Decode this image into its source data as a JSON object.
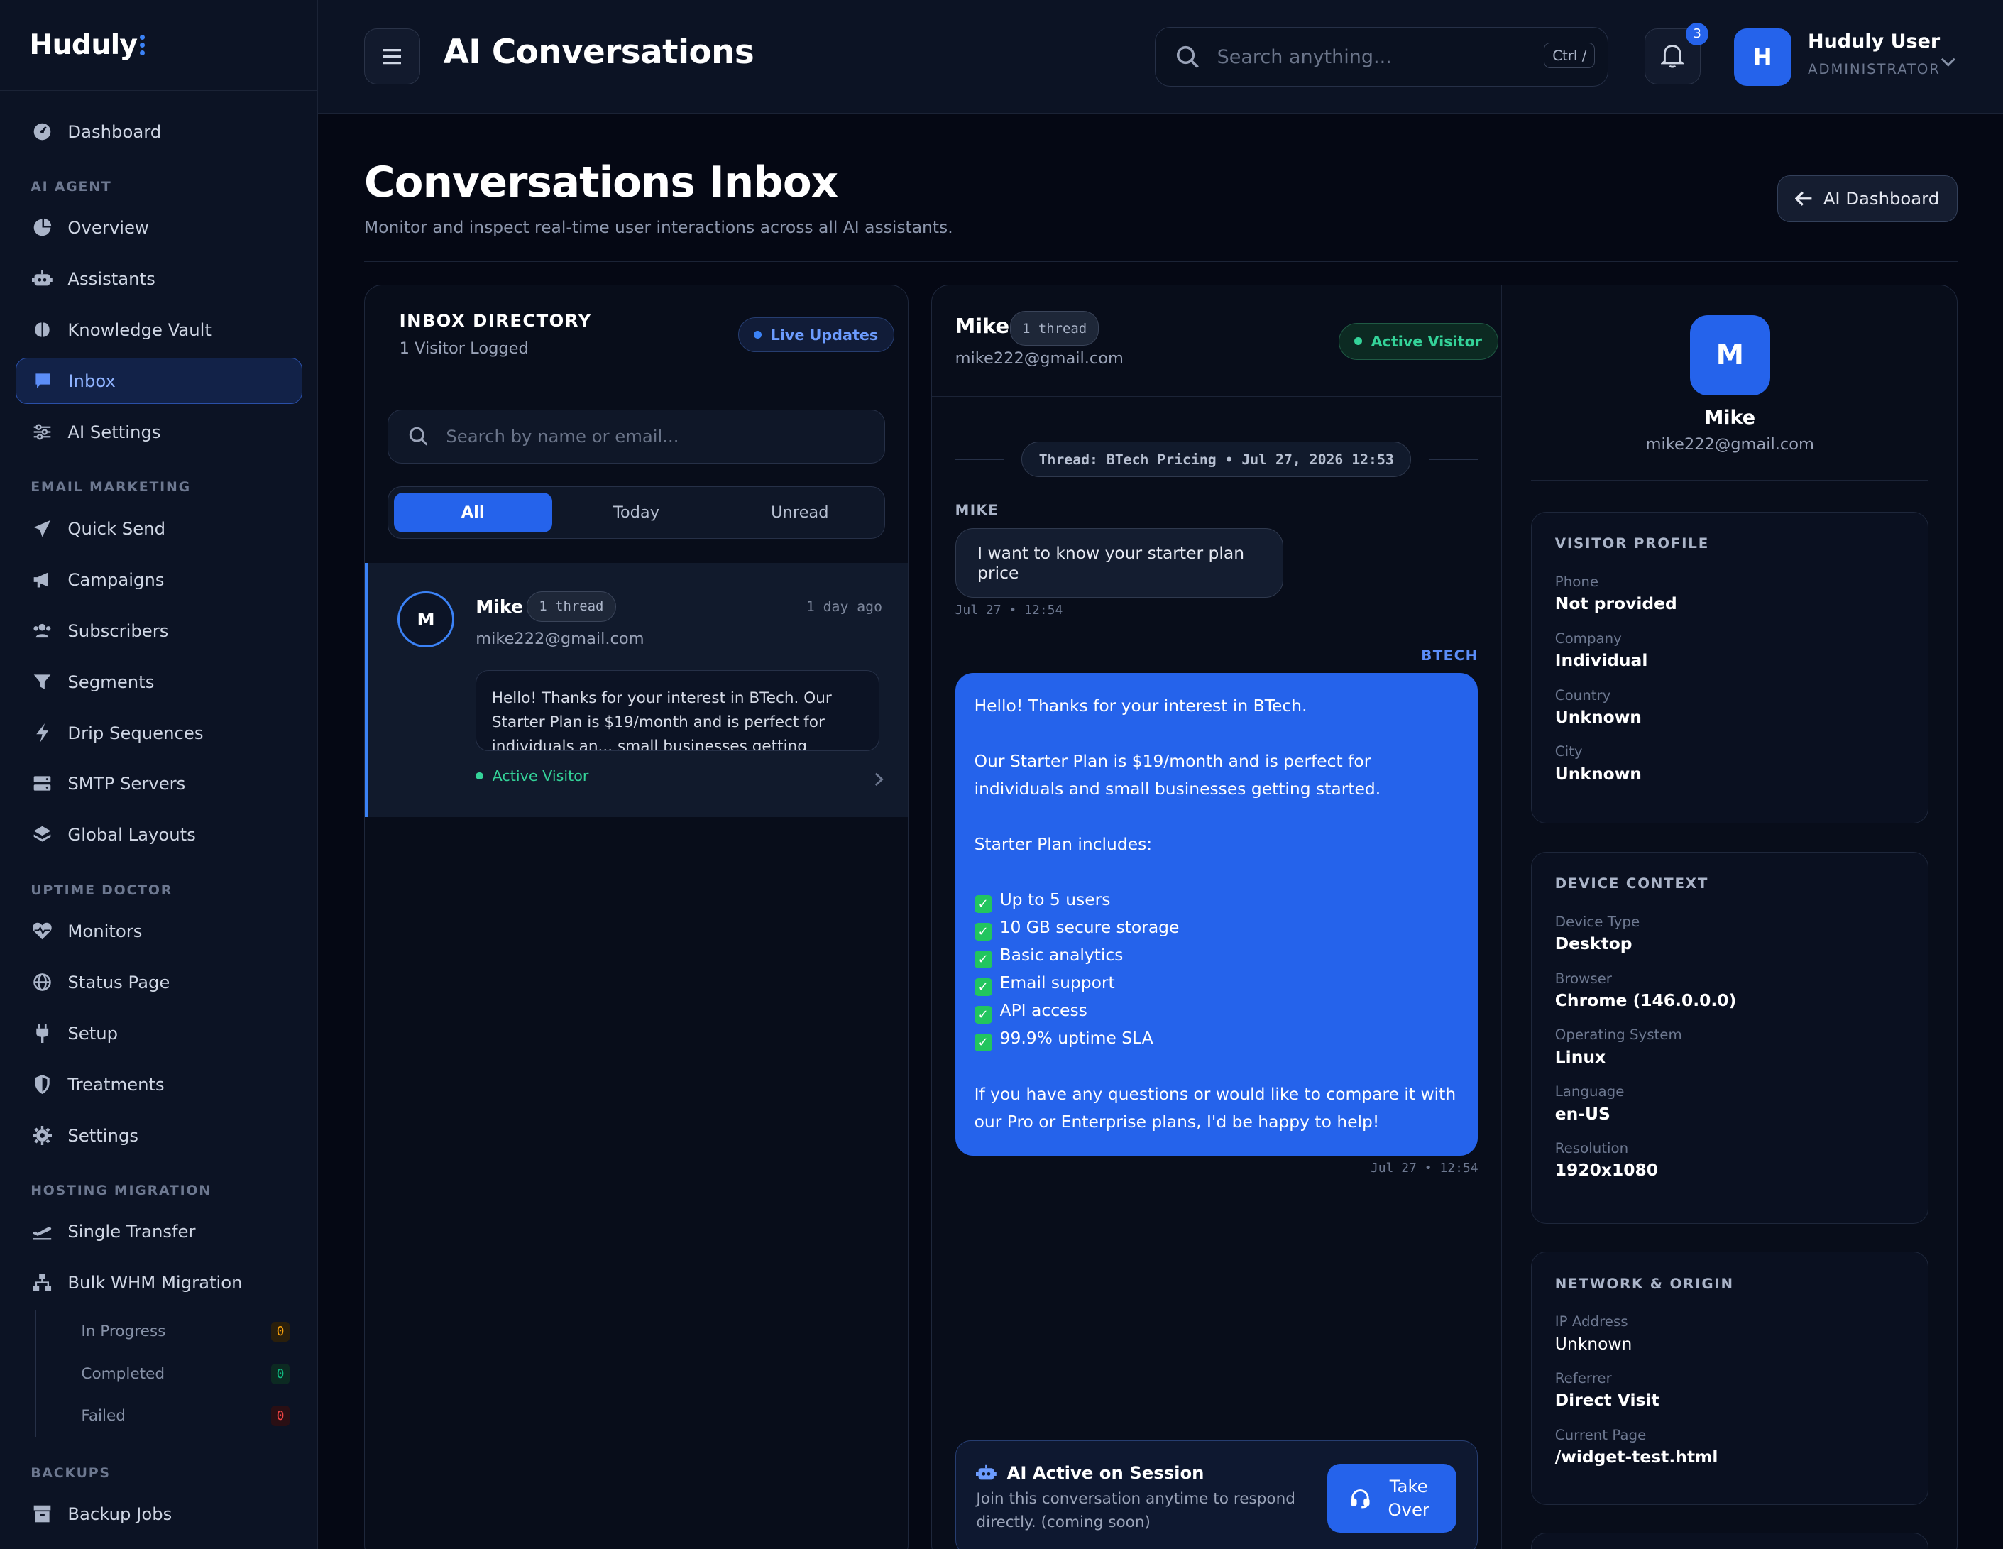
{
  "app": {
    "logo": "Huduly",
    "top_title": "AI Conversations"
  },
  "sidebar": {
    "dashboard": "Dashboard",
    "sections": [
      {
        "title": "AI AGENT",
        "items": [
          "Overview",
          "Assistants",
          "Knowledge Vault",
          "Inbox",
          "AI Settings"
        ]
      },
      {
        "title": "EMAIL MARKETING",
        "items": [
          "Quick Send",
          "Campaigns",
          "Subscribers",
          "Segments",
          "Drip Sequences",
          "SMTP Servers",
          "Global Layouts"
        ]
      },
      {
        "title": "UPTIME DOCTOR",
        "items": [
          "Monitors",
          "Status Page",
          "Setup",
          "Treatments",
          "Settings"
        ]
      },
      {
        "title": "HOSTING MIGRATION",
        "items": [
          "Single Transfer",
          "Bulk WHM Migration"
        ]
      },
      {
        "title": "BACKUPS",
        "items": [
          "Backup Jobs"
        ]
      }
    ],
    "sub_items": [
      {
        "label": "In Progress",
        "count": "0",
        "color": "#f59e0b"
      },
      {
        "label": "Completed",
        "count": "0",
        "color": "#10b981"
      },
      {
        "label": "Failed",
        "count": "0",
        "color": "#ef4444"
      }
    ]
  },
  "topbar": {
    "search_placeholder": "Search anything...",
    "shortcut": "Ctrl /",
    "notifications": "3",
    "user_initial": "H",
    "user_name": "Huduly User",
    "user_role": "ADMINISTRATOR"
  },
  "page": {
    "title": "Conversations Inbox",
    "subtitle": "Monitor and inspect real-time user interactions across all AI assistants.",
    "back_button": "AI Dashboard"
  },
  "inbox": {
    "title": "INBOX DIRECTORY",
    "count": "1 Visitor Logged",
    "live": "Live Updates",
    "search_placeholder": "Search by name or email...",
    "tabs": [
      "All",
      "Today",
      "Unread"
    ],
    "items": [
      {
        "initial": "M",
        "name": "Mike",
        "threads": "1 thread",
        "time": "1 day ago",
        "email": "mike222@gmail.com",
        "preview": "Hello! Thanks for your interest in BTech. Our Starter Plan is $19/month and is perfect for individuals an... small businesses getting started. Starter Plan",
        "status": "Active Visitor"
      }
    ]
  },
  "chat": {
    "name": "Mike",
    "threads": "1 thread",
    "email": "mike222@gmail.com",
    "status": "Active Visitor",
    "thread_label": "Thread: BTech Pricing • Jul 27, 2026 12:53",
    "messages": [
      {
        "sender": "MIKE",
        "text": "I want to know your starter plan price",
        "time": "Jul 27 • 12:54"
      },
      {
        "sender": "BTECH",
        "time": "Jul 27 • 12:54",
        "intro": "Hello! Thanks for your interest in BTech.",
        "plan": "Our Starter Plan is $19/month and is perfect for individuals and small businesses getting started.",
        "includes": "Starter Plan includes:",
        "features": [
          "Up to 5 users",
          "10 GB secure storage",
          "Basic analytics",
          "Email support",
          "API access",
          "99.9% uptime SLA"
        ],
        "outro": "If you have any questions or would like to compare it with our Pro or Enterprise plans, I'd be happy to help!"
      }
    ],
    "takeover": {
      "title": "AI Active on Session",
      "subtitle": "Join this conversation anytime to respond directly. (coming soon)",
      "button": "Take Over"
    }
  },
  "visitor": {
    "initial": "M",
    "name": "Mike",
    "email": "mike222@gmail.com",
    "profile": {
      "title": "VISITOR PROFILE",
      "fields": [
        {
          "label": "Phone",
          "value": "Not provided"
        },
        {
          "label": "Company",
          "value": "Individual"
        },
        {
          "label": "Country",
          "value": "Unknown"
        },
        {
          "label": "City",
          "value": "Unknown"
        }
      ]
    },
    "device": {
      "title": "DEVICE CONTEXT",
      "fields": [
        {
          "label": "Device Type",
          "value": "Desktop"
        },
        {
          "label": "Browser",
          "value": "Chrome (146.0.0.0)"
        },
        {
          "label": "Operating System",
          "value": "Linux"
        },
        {
          "label": "Language",
          "value": "en-US"
        },
        {
          "label": "Resolution",
          "value": "1920x1080"
        }
      ]
    },
    "network": {
      "title": "NETWORK & ORIGIN",
      "fields": [
        {
          "label": "IP Address",
          "value": "Unknown"
        },
        {
          "label": "Referrer",
          "value": "Direct Visit"
        },
        {
          "label": "Current Page",
          "value": "/widget-test.html"
        }
      ]
    }
  },
  "colors": {
    "accent": "#2563eb",
    "success": "#34d399",
    "background": "#050814"
  }
}
